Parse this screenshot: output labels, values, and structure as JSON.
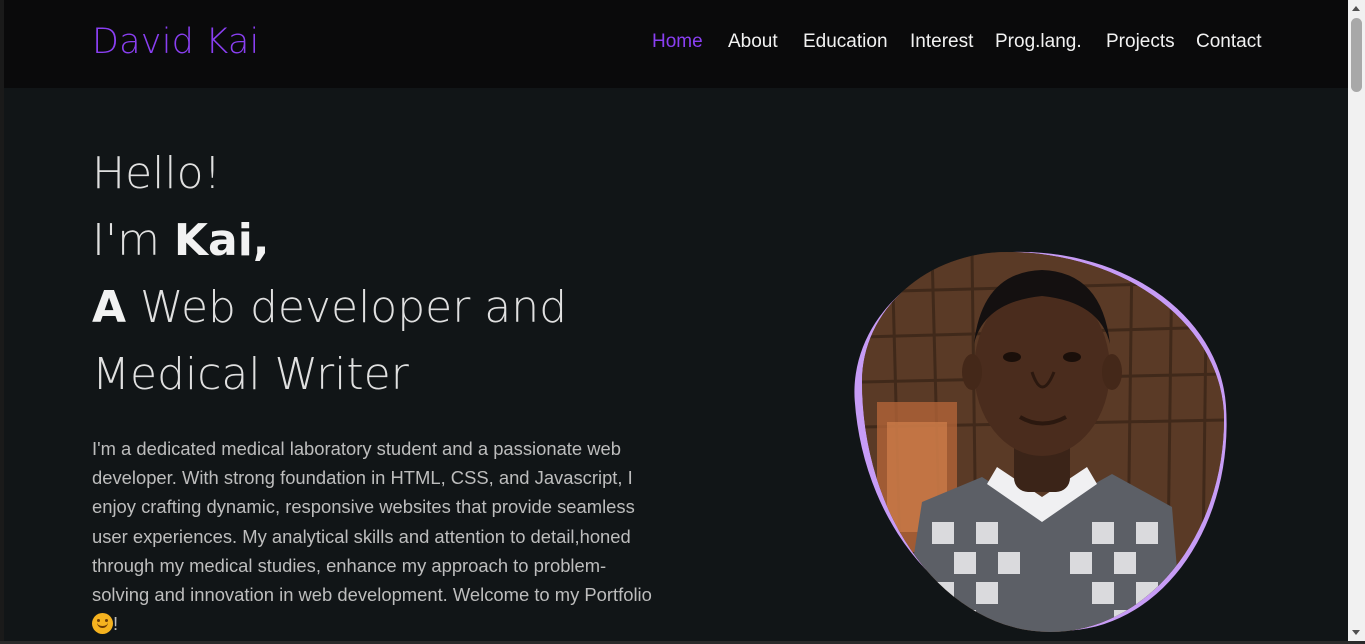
{
  "navbar": {
    "brand": "David Kai",
    "links": [
      {
        "label": "Home",
        "active": true
      },
      {
        "label": "About"
      },
      {
        "label": "Education"
      },
      {
        "label": "Interest"
      },
      {
        "label": "Prog.lang."
      },
      {
        "label": "Projects"
      },
      {
        "label": "Contact"
      }
    ]
  },
  "hero": {
    "greeting": "Hello!",
    "im_prefix": "I'm ",
    "name": "Kai,",
    "article": "A",
    "role_line1": " Web developer and",
    "role_line2": "Medical Writer",
    "paragraph": "I'm a dedicated medical laboratory student and a passionate web developer. With strong foundation in HTML, CSS, and Javascript, I enjoy crafting dynamic, responsive websites that provide seamless user experiences. My analytical skills and attention to detail,honed through my medical studies, enhance my approach to problem-solving and innovation in web development. Welcome to my Portfolio",
    "paragraph_end": "!",
    "emoji": "smiling-face-icon",
    "photo_alt": "portrait-photo"
  },
  "colors": {
    "accent": "#8a3ff2",
    "nav_bg": "#0a0a0b",
    "page_bg": "#111517",
    "blob_accent": "#c79cf6",
    "text_primary": "#e0e0e0",
    "text_secondary": "#bdbdbd"
  }
}
